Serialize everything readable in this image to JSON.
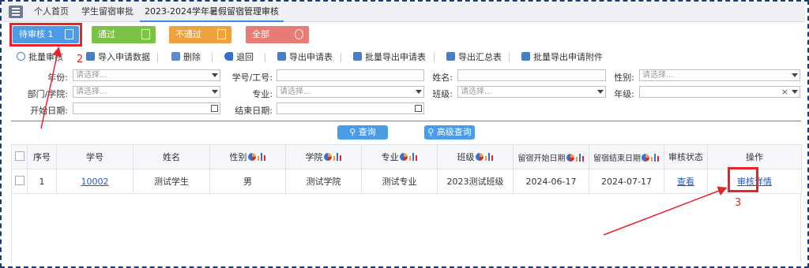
{
  "tabs": [
    {
      "label": "个人首页"
    },
    {
      "label": "学生留宿审批"
    },
    {
      "label": "2023-2024学年暑假留宿管理审核"
    }
  ],
  "status_buttons": [
    {
      "label": "待审核 1",
      "color": "#4a9be8",
      "icon": "document-edit-icon"
    },
    {
      "label": "通过",
      "color": "#7cc246",
      "icon": "document-icon"
    },
    {
      "label": "不通过",
      "color": "#eea23f",
      "icon": "image-icon"
    },
    {
      "label": "全部",
      "color": "#e77b76",
      "icon": "layers-icon"
    }
  ],
  "toolbar": [
    {
      "label": "批量审核",
      "icon": "check-circle-icon"
    },
    {
      "label": "导入申请数据",
      "icon": "import-icon"
    },
    {
      "label": "删除",
      "icon": "trash-icon"
    },
    {
      "label": "退回",
      "icon": "undo-icon"
    },
    {
      "label": "导出申请表",
      "icon": "export-icon"
    },
    {
      "label": "批量导出申请表",
      "icon": "export-icon"
    },
    {
      "label": "导出汇总表",
      "icon": "export-icon"
    },
    {
      "label": "批量导出申请附件",
      "icon": "export-icon"
    }
  ],
  "filters": {
    "year": {
      "label": "年份:",
      "placeholder": "请选择..."
    },
    "student_id": {
      "label": "学号/工号:",
      "value": ""
    },
    "name": {
      "label": "姓名:",
      "value": ""
    },
    "gender": {
      "label": "性别:",
      "placeholder": "请选择..."
    },
    "department": {
      "label": "部门/学院:",
      "placeholder": "请选择..."
    },
    "major": {
      "label": "专业:",
      "placeholder": "请选择..."
    },
    "class": {
      "label": "班级:",
      "placeholder": "请选择..."
    },
    "grade": {
      "label": "年级:",
      "value": "",
      "clear": "×"
    },
    "start_date": {
      "label": "开始日期:",
      "value": ""
    },
    "end_date": {
      "label": "结束日期:",
      "value": ""
    }
  },
  "buttons": {
    "search": "查询",
    "advanced_search": "高级查询"
  },
  "table": {
    "columns": [
      "序号",
      "学号",
      "姓名",
      "性别",
      "学院",
      "专业",
      "班级",
      "留宿开始日期",
      "留宿结束日期",
      "审核状态",
      "操作"
    ],
    "rows": [
      {
        "index": "1",
        "student_id": "10002",
        "name": "测试学生",
        "gender": "男",
        "college": "测试学院",
        "major": "测试专业",
        "class": "2023测试班级",
        "start": "2024-06-17",
        "end": "2024-07-17",
        "status": "查看",
        "action": "审核详情"
      }
    ]
  },
  "annotations": {
    "callout_2": "2",
    "callout_3": "3",
    "color": "#e8242a"
  }
}
